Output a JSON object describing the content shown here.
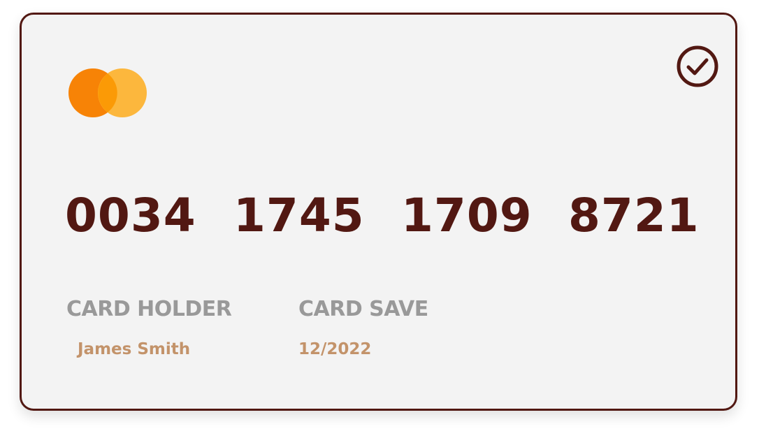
{
  "card": {
    "brand_icon": "mastercard-logo-icon",
    "selected_icon": "check-circle-icon",
    "number_groups": [
      "0034",
      "1745",
      "1709",
      "8721"
    ],
    "holder_label": "CARD HOLDER",
    "holder_name": "James Smith",
    "save_label": "CARD SAVE",
    "save_date": "12/2022"
  },
  "colors": {
    "border": "#521812",
    "number": "#521812",
    "label": "#999999",
    "value": "#c3936a",
    "background": "#f3f3f3",
    "logo_left": "#f78306",
    "logo_right": "#fdb22e"
  }
}
